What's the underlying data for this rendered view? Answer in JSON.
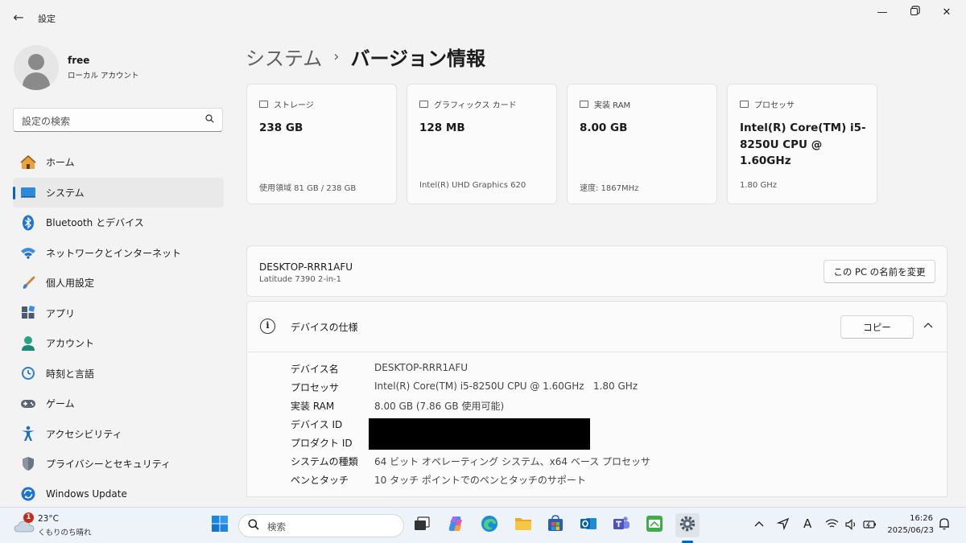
{
  "window": {
    "title": "設定",
    "back_icon": "arrow-left-icon",
    "controls": [
      "minimize-icon",
      "restore-icon",
      "close-icon"
    ]
  },
  "user": {
    "name": "free",
    "account_type": "ローカル アカウント"
  },
  "search": {
    "placeholder": "設定の検索"
  },
  "sidebar": {
    "items": [
      {
        "label": "ホーム",
        "icon": "home-icon"
      },
      {
        "label": "システム",
        "icon": "system-icon",
        "active": true
      },
      {
        "label": "Bluetooth とデバイス",
        "icon": "bluetooth-icon"
      },
      {
        "label": "ネットワークとインターネット",
        "icon": "wifi-icon"
      },
      {
        "label": "個人用設定",
        "icon": "brush-icon"
      },
      {
        "label": "アプリ",
        "icon": "apps-icon"
      },
      {
        "label": "アカウント",
        "icon": "account-icon"
      },
      {
        "label": "時刻と言語",
        "icon": "clock-globe-icon"
      },
      {
        "label": "ゲーム",
        "icon": "gamepad-icon"
      },
      {
        "label": "アクセシビリティ",
        "icon": "accessibility-icon"
      },
      {
        "label": "プライバシーとセキュリティ",
        "icon": "shield-icon"
      },
      {
        "label": "Windows Update",
        "icon": "windows-update-icon"
      }
    ]
  },
  "breadcrumb": {
    "parent": "システム",
    "separator": "›",
    "current": "バージョン情報"
  },
  "cards": [
    {
      "title": "ストレージ",
      "value": "238 GB",
      "sub": "使用領域 81 GB / 238 GB",
      "icon": "storage-icon"
    },
    {
      "title": "グラフィックス カード",
      "value": "128 MB",
      "sub": "Intel(R) UHD Graphics 620",
      "icon": "gpu-icon"
    },
    {
      "title": "実装 RAM",
      "value": "8.00 GB",
      "sub": "速度: 1867MHz",
      "icon": "ram-icon"
    },
    {
      "title": "プロセッサ",
      "value": "Intel(R) Core(TM) i5-8250U CPU @ 1.60GHz",
      "sub": "1.80 GHz",
      "icon": "cpu-icon"
    }
  ],
  "device": {
    "name": "DESKTOP-RRR1AFU",
    "model": "Latitude 7390 2-in-1",
    "rename_button": "この PC の名前を変更"
  },
  "specs": {
    "title": "デバイスの仕様",
    "copy_button": "コピー",
    "rows": [
      {
        "key": "デバイス名",
        "value": "DESKTOP-RRR1AFU"
      },
      {
        "key": "プロセッサ",
        "value": "Intel(R) Core(TM) i5-8250U CPU @ 1.60GHz   1.80 GHz"
      },
      {
        "key": "実装 RAM",
        "value": "8.00 GB (7.86 GB 使用可能)"
      },
      {
        "key": "デバイス ID",
        "value": ""
      },
      {
        "key": "プロダクト ID",
        "value": ""
      },
      {
        "key": "システムの種類",
        "value": "64 ビット オペレーティング システム、x64 ベース プロセッサ"
      },
      {
        "key": "ペンとタッチ",
        "value": "10 タッチ ポイントでのペンとタッチのサポート"
      }
    ]
  },
  "taskbar": {
    "weather": {
      "badge": "1",
      "temp": "23°C",
      "condition": "くもりのち晴れ"
    },
    "search_placeholder": "検索",
    "apps": [
      "windows-start-icon",
      "task-view-icon",
      "copilot-icon",
      "edge-icon",
      "file-explorer-icon",
      "store-icon",
      "outlook-icon",
      "teams-icon",
      "app-icon",
      "settings-icon"
    ],
    "tray": [
      "chevron-up-icon",
      "location-icon",
      "ime-icon",
      "wifi-icon",
      "battery-icon"
    ],
    "ime_label": "A",
    "time": "16:26",
    "date": "2025/06/23"
  },
  "colors": {
    "accent": "#0067c0",
    "background": "#f3f3f3",
    "card": "#fbfbfb"
  }
}
